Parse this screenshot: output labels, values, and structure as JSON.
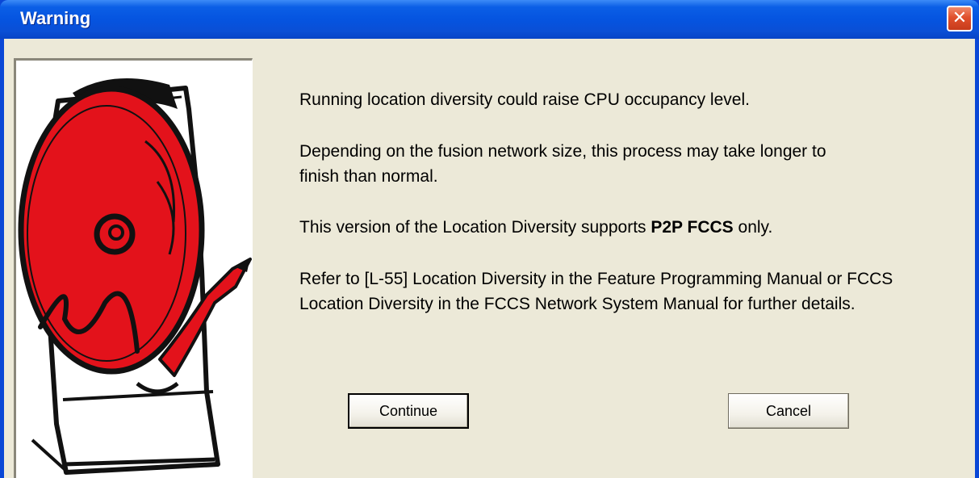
{
  "window": {
    "title": "Warning",
    "close_glyph": "✕"
  },
  "message": {
    "line1": "Running location diversity could raise CPU occupancy level.",
    "para2": "Depending on the fusion network size, this process may take longer to finish than normal.",
    "para3_prefix": "This version of the Location Diversity supports ",
    "para3_bold": "P2P FCCS",
    "para3_suffix": " only.",
    "para4": "Refer to [L-55] Location Diversity in the Feature Programming Manual or FCCS Location Diversity in the FCCS Network System Manual for further details."
  },
  "buttons": {
    "continue_label": "Continue",
    "cancel_label": "Cancel"
  },
  "illustration": {
    "icon": "red-bell-icon",
    "accent": "#e3121b"
  }
}
